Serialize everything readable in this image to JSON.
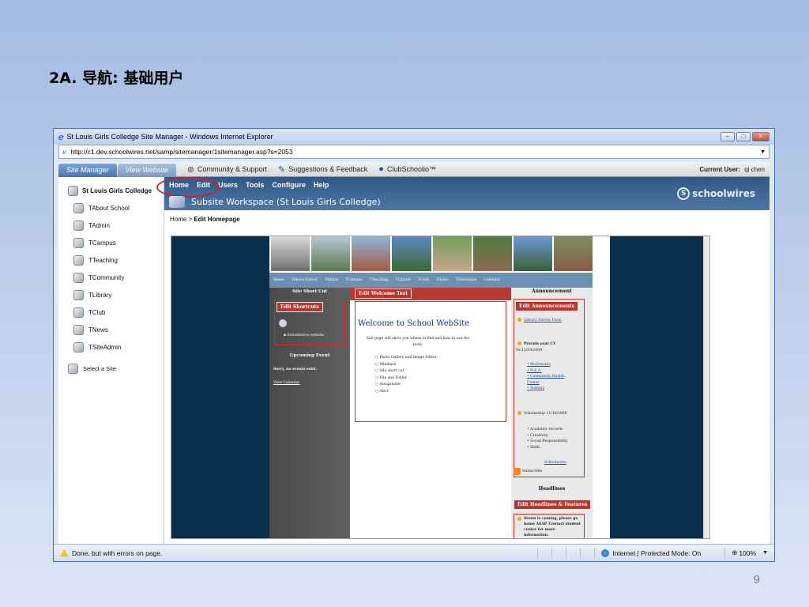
{
  "slide": {
    "title": "2A.  导航:  基础用户",
    "page_number": "9"
  },
  "browser": {
    "window_title": "St Louis Girls Colledge Site Manager - Windows Internet Explorer",
    "address": "http://c1.dev.schoolwires.net/samp/sitemanager/1sitemanager.asp?s=2053",
    "status_text": "Done, but with errors on page.",
    "zone_text": "Internet | Protected Mode: On",
    "zoom": "100%"
  },
  "schoolwires": {
    "tabs": [
      "Site Manager",
      "View Website"
    ],
    "top_links": [
      {
        "icon": "community-icon",
        "label": "Community & Support"
      },
      {
        "icon": "suggestions-icon",
        "label": "Suggestions & Feedback"
      },
      {
        "icon": "clubschoolio-icon",
        "label": "ClubSchoolio™"
      }
    ],
    "current_user_label": "Current User:",
    "current_user": "qi chen",
    "menu": [
      "Home",
      "Edit",
      "Users",
      "Tools",
      "Configure",
      "Help"
    ],
    "workspace_title": "Subsite Workspace (St Louis Girls Colledge)",
    "logo_text": "schoolwires",
    "breadcrumb_home": "Home",
    "breadcrumb_sep": " > ",
    "breadcrumb_current": "Edit Homepage"
  },
  "sidebar": {
    "root": "St Louis Girls Colledge",
    "items": [
      "TAbout School",
      "TAdmin",
      "TCampus",
      "TTeaching",
      "TCommunity",
      "TLibrary",
      "TClub",
      "TNews",
      "TSiteAdmin"
    ],
    "select_site": "Select a Site"
  },
  "preview": {
    "nav": [
      "Home",
      "TAbout School",
      "TAdmin",
      "TCampus",
      "TTeaching",
      "TLibrary",
      "TClub",
      "TNews",
      "TSiteAdmin",
      "Calendar"
    ],
    "left": {
      "shortcut_header": "Site Short Cut",
      "edit_shortcuts": "Edit Shortcuts",
      "shortcut_item": "Schoolwires website",
      "upcoming_header": "Upcoming Event",
      "no_events": "Sorry, no events exist.",
      "view_calendar": "View Calendar"
    },
    "middle": {
      "edit_welcome": "Edit Welcome Text",
      "welcome_title": "Welcome to School WebSite",
      "intro": "Sub page  will show you where to find and how to use the tools:",
      "tools": [
        "Photo Gallery and Image Editor",
        "Minibase",
        "Site short cut",
        "File and Folder",
        "Assignment",
        "Alert"
      ]
    },
    "right": {
      "announcement_header": "Announcement",
      "edit_announcements": "Edit Announcements",
      "library_survey": "Library Survey Form",
      "provide_cv": "Provide your CV",
      "provide_cv_date": "Nr.11/19/2009",
      "links": [
        "McDonalds",
        "N.E.A.",
        "Community Health Center",
        "Subway"
      ],
      "scholarship": "Scholarship",
      "scholarship_date": "11/19/2009",
      "criteria": [
        "Academic records",
        "Creativity",
        "Social Responsibility",
        "Skills"
      ],
      "schoolwires_link": "Schoolwires",
      "subscribe": "Subscribe",
      "headlines_header": "Headlines",
      "edit_headlines": "Edit Headlines & Features",
      "storm_text": "Storm is coming, please go home ASAP. Contact student center for more information."
    }
  },
  "colors": {
    "highlight": "#c8232a",
    "nav_band": "#2f5886",
    "preview_band": "#0b2e4b",
    "edit_label": "#b8362f"
  }
}
